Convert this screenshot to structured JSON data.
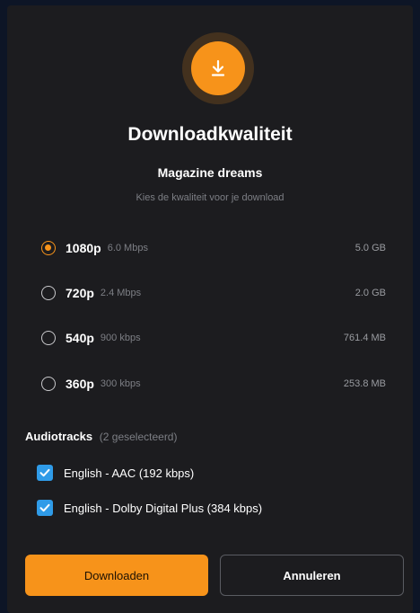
{
  "dialog": {
    "title": "Downloadkwaliteit",
    "subtitle": "Magazine dreams",
    "hint": "Kies de kwaliteit voor je download",
    "icon": "download-icon",
    "accent_color": "#f7931a",
    "checkbox_color": "#2f9be8"
  },
  "qualities": [
    {
      "label": "1080p",
      "rate": "6.0 Mbps",
      "size": "5.0 GB",
      "selected": true
    },
    {
      "label": "720p",
      "rate": "2.4 Mbps",
      "size": "2.0 GB",
      "selected": false
    },
    {
      "label": "540p",
      "rate": "900 kbps",
      "size": "761.4 MB",
      "selected": false
    },
    {
      "label": "360p",
      "rate": "300 kbps",
      "size": "253.8 MB",
      "selected": false
    }
  ],
  "audio": {
    "heading": "Audiotracks",
    "count": "(2 geselecteerd)",
    "tracks": [
      {
        "label": "English - AAC (192 kbps)",
        "checked": true
      },
      {
        "label": "English - Dolby Digital Plus (384 kbps)",
        "checked": true
      }
    ]
  },
  "buttons": {
    "download": "Downloaden",
    "cancel": "Annuleren"
  }
}
